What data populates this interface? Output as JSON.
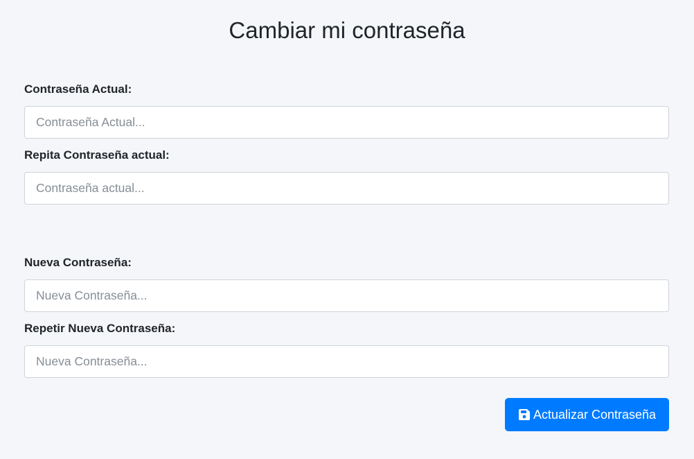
{
  "page": {
    "title": "Cambiar mi contraseña"
  },
  "form": {
    "fields": [
      {
        "label": "Contraseña Actual:",
        "placeholder": "Contraseña Actual..."
      },
      {
        "label": "Repita Contraseña actual:",
        "placeholder": "Contraseña actual..."
      },
      {
        "label": "Nueva Contraseña:",
        "placeholder": "Nueva Contraseña..."
      },
      {
        "label": "Repetir Nueva Contraseña:",
        "placeholder": "Nueva Contraseña..."
      }
    ],
    "submit": {
      "label": "Actualizar Contraseña",
      "icon": "save-icon"
    }
  },
  "colors": {
    "background": "#f4f6f9",
    "primary": "#007bff",
    "text": "#212529",
    "input_border": "#ced4da",
    "placeholder": "#868e96"
  }
}
